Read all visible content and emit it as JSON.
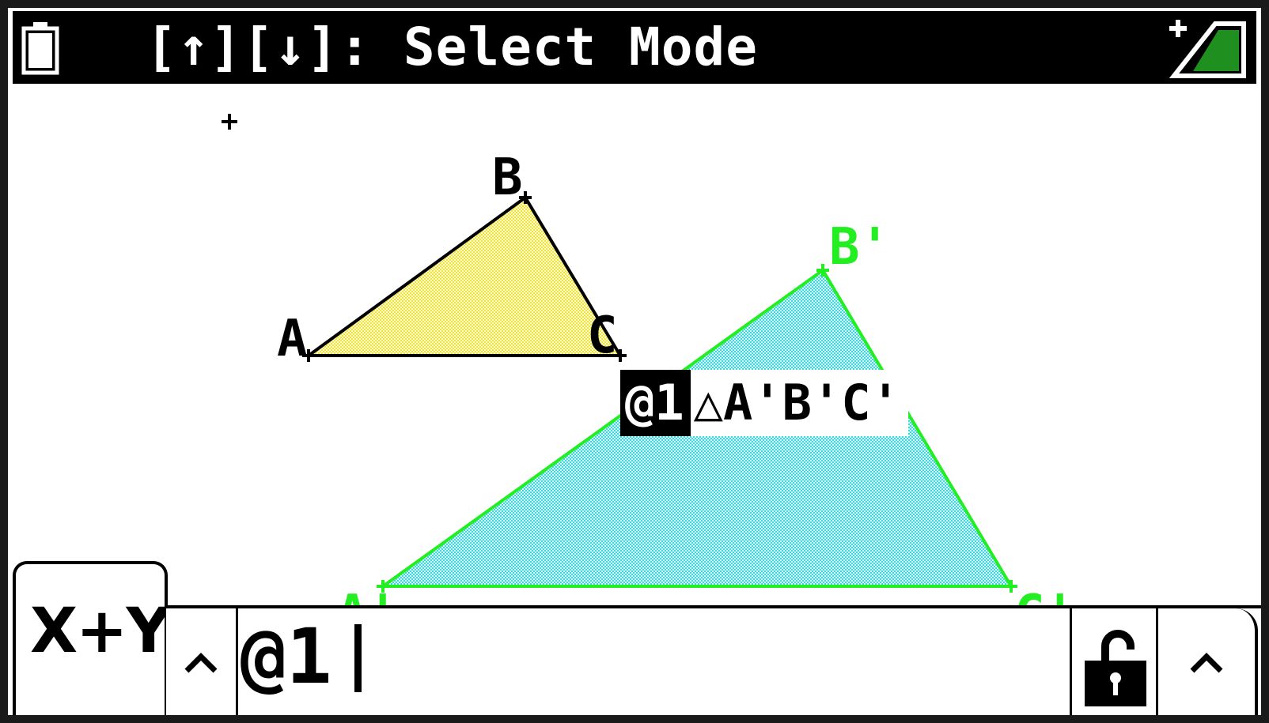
{
  "status_bar": {
    "mode_text": "[↑][↓]: Select Mode",
    "battery_icon": "battery-icon",
    "signal_icon": "power-signal-icon"
  },
  "geometry": {
    "original_triangle": {
      "vertex_labels": [
        "A",
        "B",
        "C"
      ],
      "fill_color": "#f5ee5a",
      "stroke_color": "#000000"
    },
    "image_triangle": {
      "vertex_labels": [
        "A'",
        "B'",
        "C'"
      ],
      "fill_color": "#5ee6e6",
      "stroke_color": "#22ee22"
    },
    "label_popup": {
      "index": "@1",
      "name": "△A'B'C'"
    }
  },
  "bottom_bar": {
    "tab_label": "X+Y",
    "left_button": "^",
    "input_value": "@1",
    "lock_icon": "unlock-icon",
    "right_button": "^"
  },
  "colors": {
    "accent_green": "#22ee22",
    "yellow_fill": "#f5ee5a",
    "cyan_fill": "#5ee6e6"
  }
}
